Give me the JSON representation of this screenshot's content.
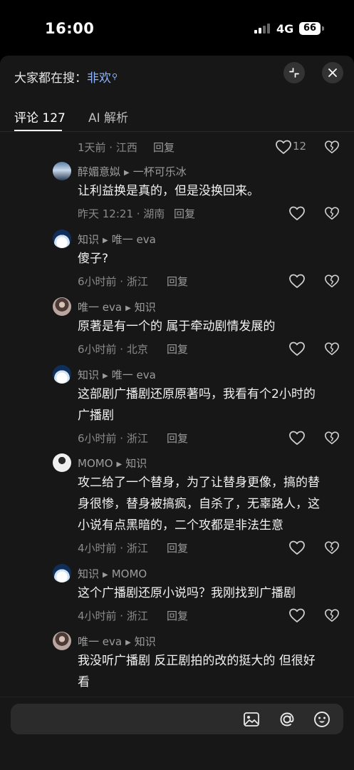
{
  "status_bar": {
    "time": "16:00",
    "network": "4G",
    "battery": "66"
  },
  "panel": {
    "search_hint_prefix": "大家都在搜：",
    "search_keyword": "非欢"
  },
  "tabs": {
    "comments": "评论 127",
    "ai": "AI 解析"
  },
  "comments": [
    {
      "time": "1天前 · 江西",
      "reply": "回复",
      "likes": "12"
    },
    {
      "author": "醉媚意姒",
      "reply_to": "一杯可乐冰",
      "text": [
        "让利益换是真的，但是没换回来。"
      ],
      "time": "昨天 12:21 · 湖南",
      "reply": "回复"
    },
    {
      "author": "知识",
      "reply_to": "唯一 eva",
      "text": [
        "傻子?"
      ],
      "time": "6小时前 · 浙江",
      "reply": "回复"
    },
    {
      "author": "唯一 eva",
      "reply_to": "知识",
      "text": [
        "原著是有一个的 属于牵动剧情发展的"
      ],
      "time": "6小时前 · 北京",
      "reply": "回复"
    },
    {
      "author": "知识",
      "reply_to": "唯一 eva",
      "text": [
        "这部剧广播剧还原原著吗，我看有个2小时的",
        "广播剧"
      ],
      "time": "6小时前 · 浙江",
      "reply": "回复"
    },
    {
      "author": "MOMO",
      "reply_to": "知识",
      "text": [
        "攻二给了一个替身，为了让替身更像，搞的替",
        "身很惨，替身被搞疯，自杀了，无辜路人，这",
        "小说有点黑暗的，二个攻都是非法生意"
      ],
      "time": "4小时前 · 浙江",
      "reply": "回复"
    },
    {
      "author": "知识",
      "reply_to": "MOMO",
      "text": [
        "这个广播剧还原小说吗？我刚找到广播剧"
      ],
      "time": "4小时前 · 浙江",
      "reply": "回复"
    },
    {
      "author": "唯一 eva",
      "reply_to": "知识",
      "text": [
        "我没听广播剧 反正剧拍的改的挺大的 但很好",
        "看"
      ]
    }
  ],
  "input": {
    "placeholder": ""
  },
  "icons": {
    "like": "heart-outline-icon",
    "dislike": "broken-heart-icon",
    "image": "image-icon",
    "mention": "at-icon",
    "emoji": "emoji-icon",
    "collapse": "collapse-icon",
    "close": "close-icon"
  },
  "colors": {
    "accent_keyword": "#8fb4ff",
    "background": "#171717"
  }
}
